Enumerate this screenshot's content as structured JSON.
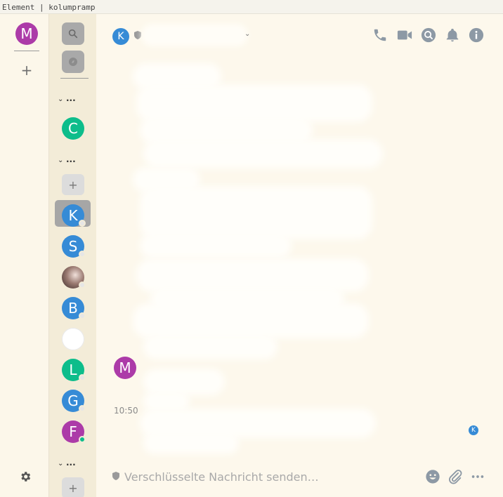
{
  "window": {
    "title": "Element | kolumpramp"
  },
  "colors": {
    "me_avatar": "#ac3ba8",
    "teal": "#0dbd8b",
    "blue": "#368bd6",
    "icon_grey": "#8d99a5",
    "online": "#0dbd8b"
  },
  "space_panel": {
    "me_initial": "M",
    "add_label": "+"
  },
  "room_list": {
    "sections": [
      {
        "chevron": "⌄",
        "label": "..."
      },
      {
        "chevron": "⌄",
        "label": "..."
      },
      {
        "chevron": "⌄",
        "label": "..."
      }
    ],
    "rooms": [
      {
        "initial": "C",
        "color": "#0dbd8b"
      },
      {
        "initial": "K",
        "color": "#368bd6"
      },
      {
        "initial": "S",
        "color": "#368bd6"
      },
      {
        "initial": "",
        "color": "#7a5a52"
      },
      {
        "initial": "B",
        "color": "#368bd6"
      },
      {
        "initial": "",
        "color": "#ffffff"
      },
      {
        "initial": "L",
        "color": "#0dbd8b"
      },
      {
        "initial": "G",
        "color": "#368bd6"
      },
      {
        "initial": "F",
        "color": "#ac3ba8"
      }
    ],
    "add_label": "+"
  },
  "room_header": {
    "avatar_initial": "K",
    "chevron": "⌄",
    "icons": [
      "phone-icon",
      "video-icon",
      "search-icon",
      "bell-icon",
      "info-icon"
    ]
  },
  "timeline": {
    "sender_initial": "M",
    "timestamp": "10:50",
    "read_receipt_initial": "K"
  },
  "composer": {
    "placeholder": "Verschlüsselte Nachricht senden…"
  }
}
